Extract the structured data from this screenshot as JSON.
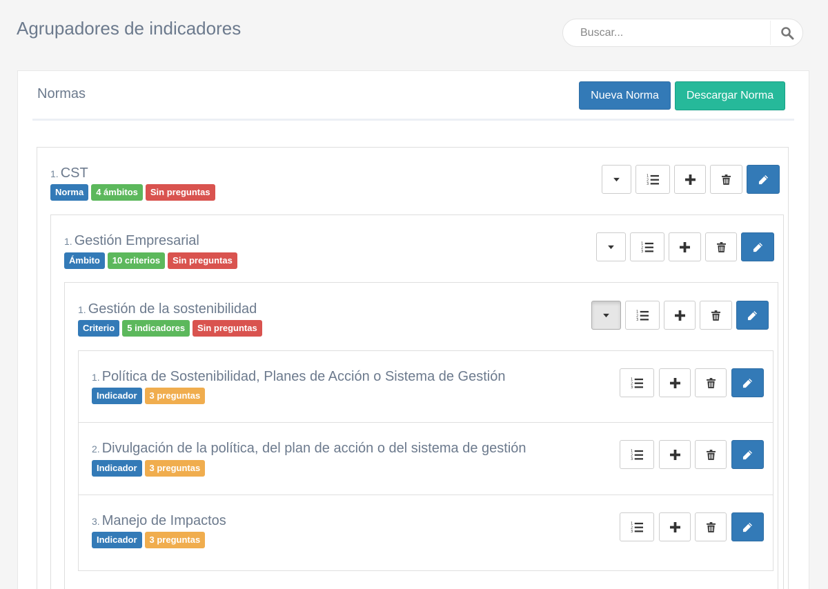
{
  "header": {
    "title": "Agrupadores de indicadores"
  },
  "search": {
    "placeholder": "Buscar..."
  },
  "panel": {
    "title": "Normas",
    "new_button": "Nueva Norma",
    "download_button": "Descargar Norma"
  },
  "items": [
    {
      "number": "1.",
      "title": "CST",
      "badges": [
        "Norma",
        "4 ámbitos",
        "Sin preguntas"
      ]
    },
    {
      "number": "1.",
      "title": "Gestión Empresarial",
      "badges": [
        "Ámbito",
        "10 criterios",
        "Sin preguntas"
      ]
    },
    {
      "number": "1.",
      "title": "Gestión de la sostenibilidad",
      "badges": [
        "Criterio",
        "5 indicadores",
        "Sin preguntas"
      ]
    },
    {
      "number": "1.",
      "title": "Política de Sostenibilidad, Planes de Acción o Sistema de Gestión",
      "badges": [
        "Indicador",
        "3 preguntas"
      ]
    },
    {
      "number": "2.",
      "title": "Divulgación de la política, del plan de acción o del sistema de gestión",
      "badges": [
        "Indicador",
        "3 preguntas"
      ]
    },
    {
      "number": "3.",
      "title": "Manejo de Impactos",
      "badges": [
        "Indicador",
        "3 preguntas"
      ]
    }
  ],
  "colors": {
    "primary": "#337ab7",
    "success": "#26b99a",
    "badge_green": "#5cb85c",
    "badge_red": "#d9534f",
    "badge_orange": "#f0ad4e"
  },
  "icons": [
    "search-icon",
    "caret-down-icon",
    "ordered-list-icon",
    "plus-icon",
    "trash-icon",
    "pencil-icon"
  ]
}
